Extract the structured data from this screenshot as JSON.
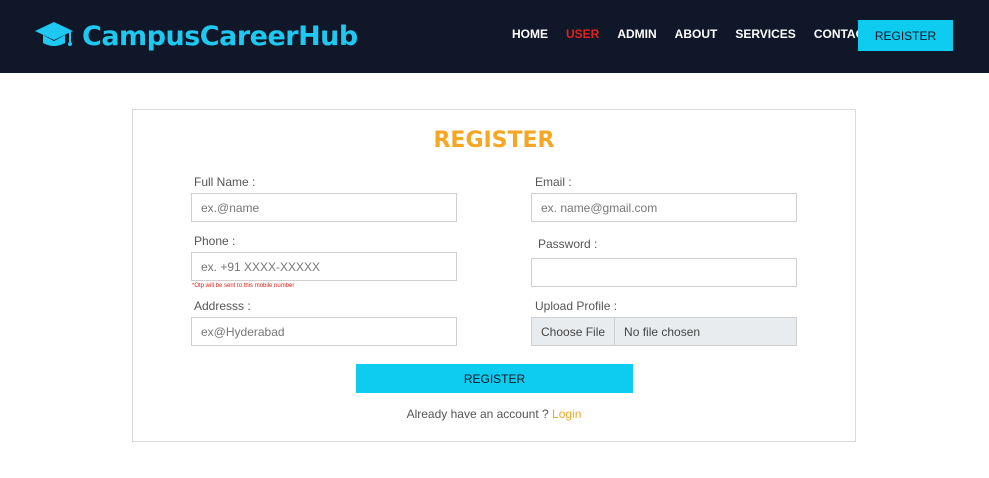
{
  "brand": {
    "name": "CampusCareerHub",
    "icon": "graduation-cap-icon",
    "color": "#1ec8f0"
  },
  "nav": {
    "items": [
      {
        "label": "HOME",
        "active": false
      },
      {
        "label": "USER",
        "active": true
      },
      {
        "label": "ADMIN",
        "active": false
      },
      {
        "label": "ABOUT",
        "active": false
      },
      {
        "label": "SERVICES",
        "active": false
      },
      {
        "label": "CONTACT",
        "active": false
      }
    ],
    "register_label": "REGISTER",
    "active_color": "#e2231a"
  },
  "form": {
    "title": "REGISTER",
    "full_name": {
      "label": "Full Name :",
      "placeholder": "ex.@name"
    },
    "email": {
      "label": "Email :",
      "placeholder": "ex. name@gmail.com"
    },
    "phone": {
      "label": "Phone :",
      "placeholder": "ex. +91 XXXX-XXXXX",
      "note": "*Otp will be sent to this mobile number"
    },
    "password": {
      "label": "Password :",
      "placeholder": ""
    },
    "address": {
      "label": "Addresss :",
      "placeholder": "ex@Hyderabad"
    },
    "upload": {
      "label": "Upload Profile :",
      "button": "Choose File",
      "status": "No file chosen"
    },
    "submit_label": "REGISTER",
    "account_text": "Already have an account ?",
    "login_label": "Login"
  },
  "colors": {
    "navbar": "#0f1729",
    "accent": "#0ecbf0",
    "title": "#f5a623"
  }
}
